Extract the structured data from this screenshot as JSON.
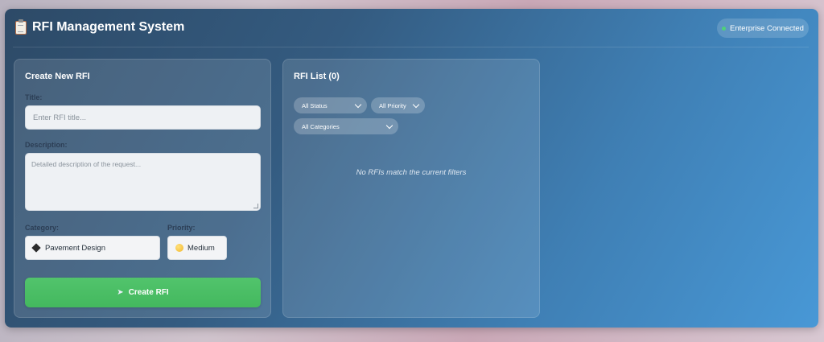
{
  "header": {
    "title": "RFI Management System",
    "title_icon": "clipboard-icon",
    "status": "Enterprise Connected",
    "status_color": "#4fd17a"
  },
  "create_panel": {
    "heading": "Create New RFI",
    "title_label": "Title:",
    "title_placeholder": "Enter RFI title...",
    "description_label": "Description:",
    "description_placeholder": "Detailed description of the request...",
    "category_label": "Category:",
    "category_value": "Pavement Design",
    "category_icon": "diamond-icon",
    "priority_label": "Priority:",
    "priority_value": "Medium",
    "priority_icon": "yellow-circle-icon",
    "submit_label": "Create RFI",
    "submit_icon": "rocket-icon",
    "submit_color": "#4abd65"
  },
  "list_panel": {
    "heading": "RFI List (0)",
    "filters": {
      "status": "All Status",
      "priority": "All Priority",
      "category": "All Categories"
    },
    "empty_message": "No RFIs match the current filters"
  }
}
